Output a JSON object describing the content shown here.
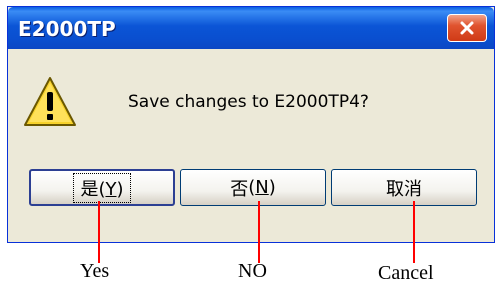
{
  "window": {
    "title": "E2000TP",
    "close_icon": "close-icon"
  },
  "dialog": {
    "icon": "warning-icon",
    "message": "Save changes to E2000TP4?",
    "buttons": {
      "yes_label": "是",
      "yes_accel": "Y",
      "no_label": "否",
      "no_accel": "N",
      "cancel_label": "取消"
    }
  },
  "annotations": {
    "yes": "Yes",
    "no": "NO",
    "cancel": "Cancel"
  },
  "colors": {
    "titlebar": "#0b55d6",
    "dialog_bg": "#ece9d8",
    "close_button": "#e0542f",
    "callout_line": "#ff0000"
  }
}
